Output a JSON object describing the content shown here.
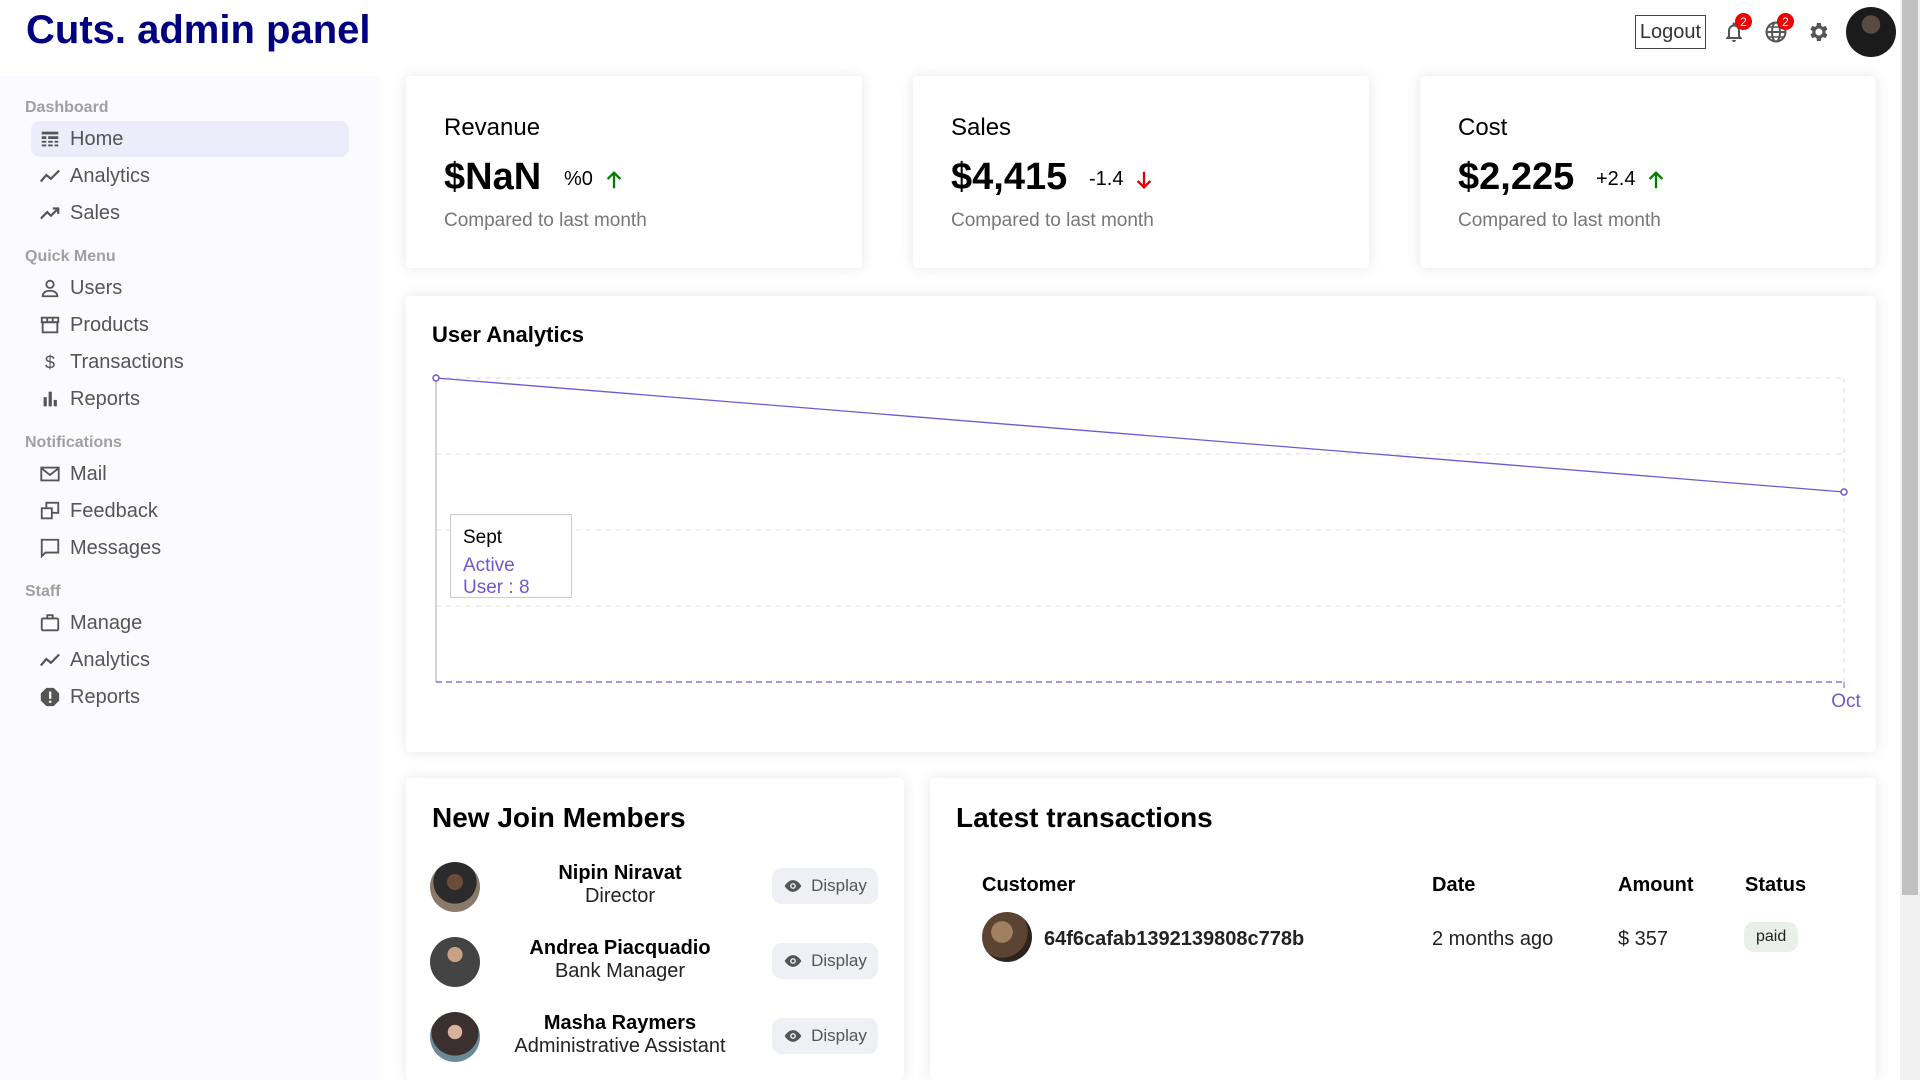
{
  "app": {
    "title": "Cuts. admin panel"
  },
  "topbar": {
    "logout_label": "Logout",
    "notifications_count": "2",
    "language_count": "2",
    "icons": [
      "bell-icon",
      "globe-icon",
      "gear-icon"
    ]
  },
  "sidebar": {
    "sections": [
      {
        "title": "Dashboard",
        "items": [
          {
            "label": "Home",
            "icon": "home-icon",
            "active": true
          },
          {
            "label": "Analytics",
            "icon": "analytics-icon"
          },
          {
            "label": "Sales",
            "icon": "trending-up-icon"
          }
        ]
      },
      {
        "title": "Quick Menu",
        "items": [
          {
            "label": "Users",
            "icon": "user-icon"
          },
          {
            "label": "Products",
            "icon": "store-icon"
          },
          {
            "label": "Transactions",
            "icon": "dollar-icon"
          },
          {
            "label": "Reports",
            "icon": "bar-chart-icon"
          }
        ]
      },
      {
        "title": "Notifications",
        "items": [
          {
            "label": "Mail",
            "icon": "mail-icon"
          },
          {
            "label": "Feedback",
            "icon": "feedback-icon"
          },
          {
            "label": "Messages",
            "icon": "chat-icon"
          }
        ]
      },
      {
        "title": "Staff",
        "items": [
          {
            "label": "Manage",
            "icon": "briefcase-icon"
          },
          {
            "label": "Analytics",
            "icon": "analytics-icon"
          },
          {
            "label": "Reports",
            "icon": "report-icon"
          }
        ]
      }
    ]
  },
  "stats": [
    {
      "title": "Revanue",
      "value": "$NaN",
      "rate": "%0",
      "direction": "up",
      "subtitle": "Compared to last month"
    },
    {
      "title": "Sales",
      "value": "$4,415",
      "rate": "-1.4",
      "direction": "down",
      "subtitle": "Compared to last month"
    },
    {
      "title": "Cost",
      "value": "$2,225",
      "rate": "+2.4",
      "direction": "up",
      "subtitle": "Compared to last month"
    }
  ],
  "user_analytics": {
    "title": "User Analytics",
    "tooltip": {
      "label": "Sept",
      "value": "Active User : 8"
    }
  },
  "chart_data": {
    "type": "line",
    "title": "User Analytics",
    "categories": [
      "Sept",
      "Oct"
    ],
    "series": [
      {
        "name": "Active User",
        "values": [
          8,
          5
        ]
      }
    ],
    "ylim": [
      0,
      8
    ],
    "x_tick_labels_visible": [
      "Oct"
    ],
    "grid": true,
    "line_color": "#6a5bd0"
  },
  "members": {
    "title": "New Join Members",
    "display_label": "Display",
    "list": [
      {
        "name": "Nipin Niravat",
        "role": "Director"
      },
      {
        "name": "Andrea Piacquadio",
        "role": "Bank Manager"
      },
      {
        "name": "Masha Raymers",
        "role": "Administrative Assistant"
      }
    ]
  },
  "transactions": {
    "title": "Latest transactions",
    "columns": [
      "Customer",
      "Date",
      "Amount",
      "Status"
    ],
    "rows": [
      {
        "customer": "64f6cafab1392139808c778b",
        "date": "2 months ago",
        "amount": "$ 357",
        "status": "paid"
      }
    ]
  },
  "colors": {
    "brand": "#000080",
    "accent": "#6a5bd0",
    "up": "#008000",
    "down": "#e00000"
  }
}
